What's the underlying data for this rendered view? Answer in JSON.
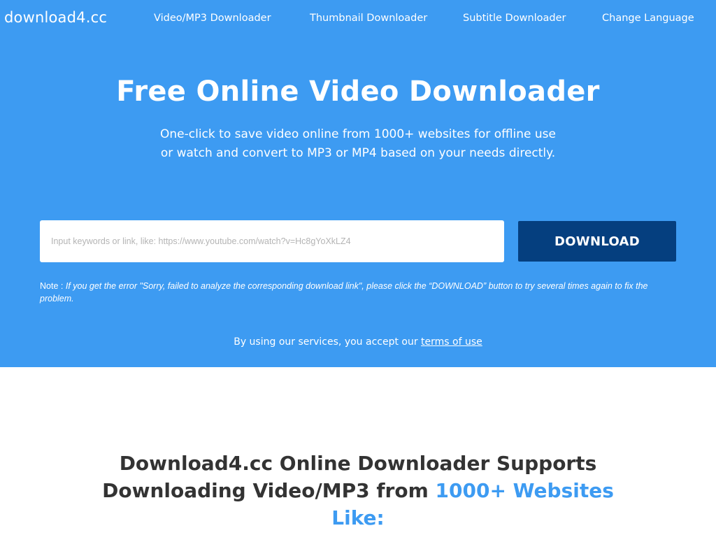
{
  "nav": {
    "logo": "download4.cc",
    "links": [
      {
        "label": "Video/MP3 Downloader"
      },
      {
        "label": "Thumbnail Downloader"
      },
      {
        "label": "Subtitle Downloader"
      },
      {
        "label": "Change Language"
      }
    ]
  },
  "hero": {
    "title": "Free Online Video Downloader",
    "subtitle": "One-click to save video online from 1000+ websites for offline use or watch and convert to MP3 or MP4 based on your needs directly.",
    "search": {
      "value": "",
      "placeholder": "Input keywords or link, like: https://www.youtube.com/watch?v=Hc8gYoXkLZ4"
    },
    "download_label": "DOWNLOAD",
    "note_label": "Note :",
    "note_text": "If you get the error \"Sorry, failed to analyze the corresponding download link\", please click the “DOWNLOAD” button to try several times again to fix the problem.",
    "terms_prefix": "By using our services, you accept our",
    "terms_link": "terms of use"
  },
  "supports": {
    "prefix": "Download4.cc Online Downloader Supports Downloading Video/MP3 from",
    "highlight": "1000+ Websites Like:"
  },
  "colors": {
    "hero_bg": "#3d9bf2",
    "button_bg": "#053f7f",
    "accent": "#3d9bf2"
  }
}
